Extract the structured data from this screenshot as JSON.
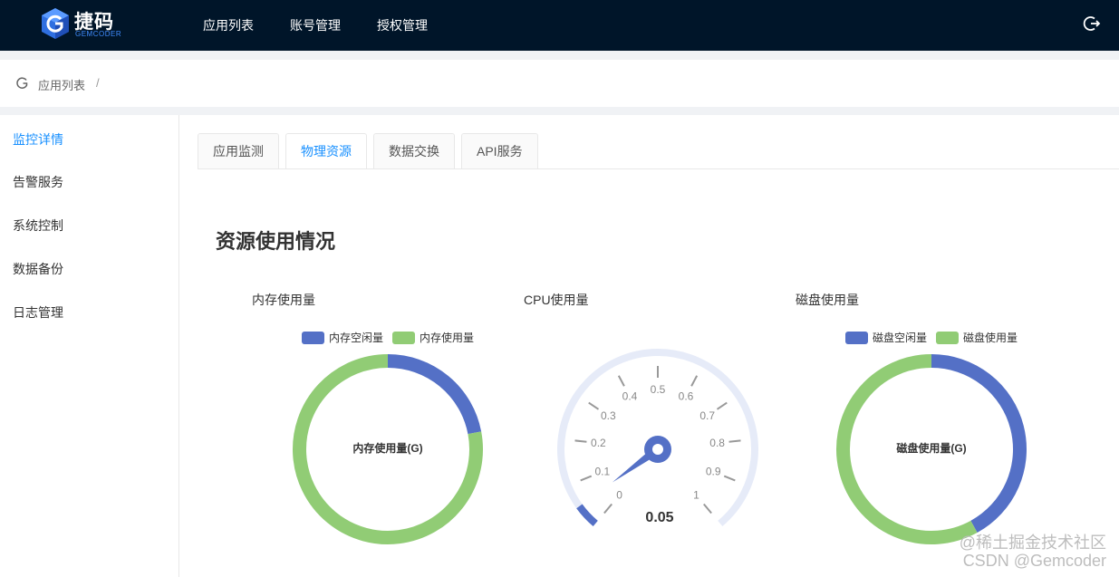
{
  "header": {
    "logo_title": "捷码",
    "logo_sub": "GEMCODER",
    "nav": [
      "应用列表",
      "账号管理",
      "授权管理"
    ]
  },
  "breadcrumb": {
    "item": "应用列表",
    "sep": "/"
  },
  "sidebar": {
    "items": [
      "监控详情",
      "告警服务",
      "系统控制",
      "数据备份",
      "日志管理"
    ],
    "active_index": 0
  },
  "tabs": [
    "应用监测",
    "物理资源",
    "数据交换",
    "API服务"
  ],
  "active_tab": 1,
  "section_title": "资源使用情况",
  "colors": {
    "blue": "#5470c6",
    "green": "#91cc75",
    "header_bg": "#001529",
    "accent": "#1890ff"
  },
  "charts": {
    "memory": {
      "title": "内存使用量",
      "legend": [
        "内存空闲量",
        "内存使用量"
      ],
      "center": "内存使用量(G)"
    },
    "cpu": {
      "title": "CPU使用量",
      "value_text": "0.05",
      "ticks": [
        "0",
        "0.1",
        "0.2",
        "0.3",
        "0.4",
        "0.5",
        "0.6",
        "0.7",
        "0.8",
        "0.9",
        "1"
      ]
    },
    "disk": {
      "title": "磁盘使用量",
      "legend": [
        "磁盘空闲量",
        "磁盘使用量"
      ],
      "center": "磁盘使用量(G)"
    }
  },
  "chart_data": [
    {
      "type": "pie",
      "title": "内存使用量",
      "categories": [
        "内存空闲量",
        "内存使用量"
      ],
      "values": [
        0.22,
        0.78
      ]
    },
    {
      "type": "gauge",
      "title": "CPU使用量",
      "value": 0.05,
      "min": 0,
      "max": 1
    },
    {
      "type": "pie",
      "title": "磁盘使用量",
      "categories": [
        "磁盘空闲量",
        "磁盘使用量"
      ],
      "values": [
        0.42,
        0.58
      ]
    }
  ],
  "watermark": [
    "@稀土掘金技术社区",
    "CSDN @Gemcoder"
  ]
}
